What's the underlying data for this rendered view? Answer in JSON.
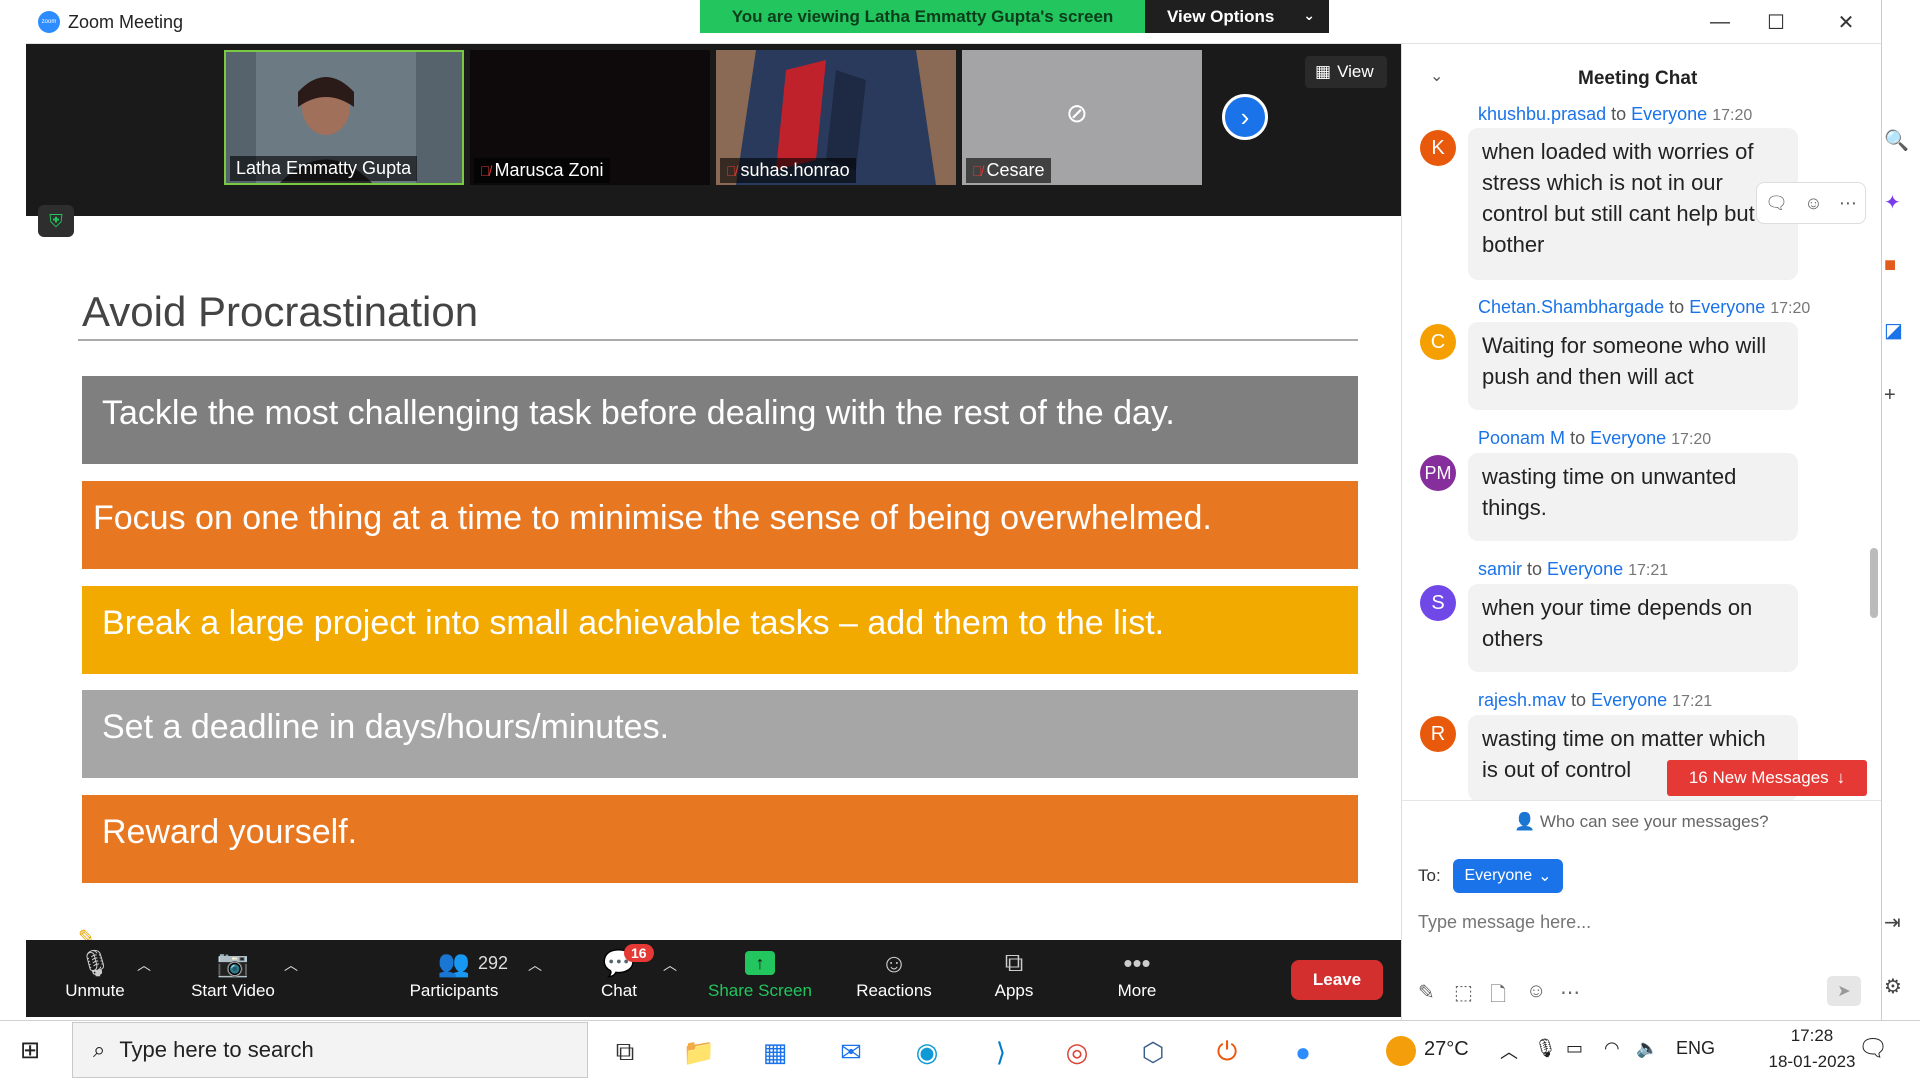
{
  "window": {
    "title": "Zoom Meeting",
    "app_icon_text": "zoom",
    "minimize": "—",
    "maximize": "☐",
    "close": "✕"
  },
  "banner": {
    "text": "You are viewing Latha Emmatty Gupta's screen",
    "view_options": "View Options"
  },
  "video_strip": {
    "view_label": "View",
    "participants": [
      {
        "name": "Latha Emmatty Gupta",
        "muted": false
      },
      {
        "name": "Marusca Zoni",
        "muted": true
      },
      {
        "name": "suhas.honrao",
        "muted": true
      },
      {
        "name": "Cesare",
        "muted": true
      }
    ]
  },
  "slide": {
    "title": "Avoid Procrastination",
    "bullets": [
      {
        "text": "Tackle the most challenging task before dealing with the rest of the day.",
        "color": "#7f7f7f"
      },
      {
        "text": "Focus on one thing at a time to minimise the sense of  being overwhelmed.",
        "color": "#e87722"
      },
      {
        "text": "Break a large project into small achievable tasks – add them to the list.",
        "color": "#f2a900"
      },
      {
        "text": "Set a deadline in days/hours/minutes.",
        "color": "#a6a6a6"
      },
      {
        "text": "Reward yourself.",
        "color": "#e87722"
      }
    ]
  },
  "toolbar": {
    "unmute": "Unmute",
    "start_video": "Start Video",
    "participants": "Participants",
    "participants_count": "292",
    "chat": "Chat",
    "chat_badge": "16",
    "share_screen": "Share Screen",
    "reactions": "Reactions",
    "apps": "Apps",
    "more": "More",
    "leave": "Leave"
  },
  "chat": {
    "title": "Meeting Chat",
    "to_word": "to",
    "messages": [
      {
        "sender": "khushbu.prasad",
        "to": "Everyone",
        "time": "17:20",
        "initials": "K",
        "avatar_color": "#e8590c",
        "text": "when loaded with worries of stress which is not in our control but still cant help but bother"
      },
      {
        "sender": "Chetan.Shambhargade",
        "to": "Everyone",
        "time": "17:20",
        "initials": "C",
        "avatar_color": "#f59f00",
        "text": "Waiting for someone who will push and then will act"
      },
      {
        "sender": "Poonam M",
        "to": "Everyone",
        "time": "17:20",
        "initials": "PM",
        "avatar_color": "#862e9c",
        "text": "wasting  time on unwanted things."
      },
      {
        "sender": "samir",
        "to": "Everyone",
        "time": "17:21",
        "initials": "S",
        "avatar_color": "#7048e8",
        "text": "when your time depends on others"
      },
      {
        "sender": "rajesh.mav",
        "to": "Everyone",
        "time": "17:21",
        "initials": "R",
        "avatar_color": "#e8590c",
        "text": "wasting time on matter which is out of control"
      }
    ],
    "new_messages": "16 New Messages",
    "who_can_see": "Who can see your messages?",
    "to_label": "To:",
    "recipient": "Everyone",
    "input_placeholder": "Type message here..."
  },
  "taskbar": {
    "search_placeholder": "Type here to search",
    "temperature": "27°C",
    "language": "ENG",
    "time": "17:28",
    "date": "18-01-2023"
  }
}
